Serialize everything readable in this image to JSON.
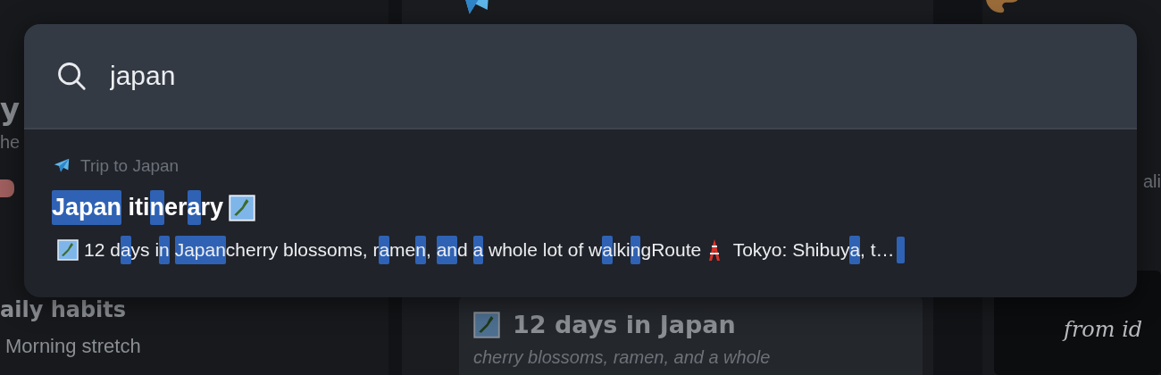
{
  "board": {
    "columns": [
      {
        "heading": "y",
        "subtitle": "he",
        "tag": {
          "color": "#a0605f"
        },
        "section": "aily habits",
        "item": "Morning stretch"
      },
      {
        "card": {
          "title": "12 days in Japan",
          "body": "cherry blossoms, ramen, and a whole"
        }
      },
      {
        "subtitle": "ali",
        "card": {
          "body": "from id"
        }
      }
    ]
  },
  "search": {
    "query": "japan"
  },
  "results": [
    {
      "breadcrumb": "Trip to Japan",
      "title": [
        {
          "kind": "text",
          "text": "Japan",
          "highlighted": true
        },
        {
          "kind": "text",
          "text": " iti",
          "highlighted": false
        },
        {
          "kind": "text",
          "text": "n",
          "highlighted": true
        },
        {
          "kind": "text",
          "text": "er",
          "highlighted": false
        },
        {
          "kind": "text",
          "text": "a",
          "highlighted": true
        },
        {
          "kind": "text",
          "text": "ry",
          "highlighted": false
        },
        {
          "kind": "map"
        }
      ],
      "snippet": [
        {
          "kind": "map"
        },
        {
          "kind": "text",
          "text": "12 d",
          "highlighted": false
        },
        {
          "kind": "text",
          "text": "a",
          "highlighted": true
        },
        {
          "kind": "text",
          "text": "ys i",
          "highlighted": false
        },
        {
          "kind": "text",
          "text": "n",
          "highlighted": true
        },
        {
          "kind": "text",
          "text": "Japan",
          "highlighted": true,
          "space_before": true
        },
        {
          "kind": "text",
          "text": "cherry blossoms, r",
          "highlighted": false
        },
        {
          "kind": "text",
          "text": "a",
          "highlighted": true
        },
        {
          "kind": "text",
          "text": "me",
          "highlighted": false
        },
        {
          "kind": "text",
          "text": "n",
          "highlighted": true
        },
        {
          "kind": "text",
          "text": ", ",
          "highlighted": false
        },
        {
          "kind": "text",
          "text": "an",
          "highlighted": true
        },
        {
          "kind": "text",
          "text": "d ",
          "highlighted": false
        },
        {
          "kind": "text",
          "text": "a",
          "highlighted": true
        },
        {
          "kind": "text",
          "text": " whole lot of w",
          "highlighted": false
        },
        {
          "kind": "text",
          "text": "a",
          "highlighted": true
        },
        {
          "kind": "text",
          "text": "lki",
          "highlighted": false
        },
        {
          "kind": "text",
          "text": "n",
          "highlighted": true
        },
        {
          "kind": "text",
          "text": "gRoute",
          "highlighted": false
        },
        {
          "kind": "tower"
        },
        {
          "kind": "text",
          "text": " Tokyo: Shibuy",
          "highlighted": false
        },
        {
          "kind": "text",
          "text": "a",
          "highlighted": true
        },
        {
          "kind": "text",
          "text": ", t…",
          "highlighted": false
        }
      ],
      "trailing_match": true
    }
  ]
}
